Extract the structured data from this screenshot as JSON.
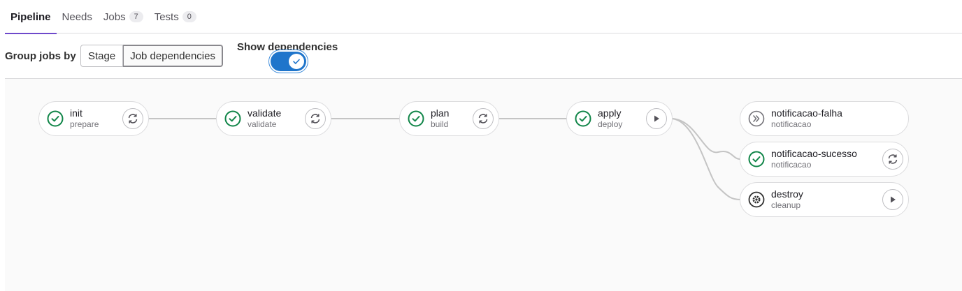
{
  "tabs": [
    {
      "label": "Pipeline",
      "count": null
    },
    {
      "label": "Needs",
      "count": null
    },
    {
      "label": "Jobs",
      "count": "7"
    },
    {
      "label": "Tests",
      "count": "0"
    }
  ],
  "toolbar": {
    "group_label": "Group jobs by",
    "stage_label": "Stage",
    "job_dependencies_label": "Job dependencies",
    "selected_grouping": "Job dependencies",
    "show_dependencies_label": "Show dependencies",
    "show_dependencies_on": true
  },
  "jobs": [
    {
      "name": "init",
      "stage": "prepare",
      "status": "success",
      "action": "retry"
    },
    {
      "name": "validate",
      "stage": "validate",
      "status": "success",
      "action": "retry"
    },
    {
      "name": "plan",
      "stage": "build",
      "status": "success",
      "action": "retry"
    },
    {
      "name": "apply",
      "stage": "deploy",
      "status": "success",
      "action": "play"
    },
    {
      "name": "notificacao-falha",
      "stage": "notificacao",
      "status": "skipped",
      "action": "none"
    },
    {
      "name": "notificacao-sucesso",
      "stage": "notificacao",
      "status": "success",
      "action": "retry"
    },
    {
      "name": "destroy",
      "stage": "cleanup",
      "status": "manual",
      "action": "play"
    }
  ],
  "colors": {
    "success": "#108548",
    "tab_accent": "#6e49cb",
    "toggle": "#1f75cb",
    "link": "#c4c4c4"
  },
  "icons": {
    "success": "status-success-icon",
    "skipped": "status-skipped-icon",
    "manual": "status-manual-gear-icon",
    "retry": "retry-icon",
    "play": "play-icon",
    "check": "check-icon"
  }
}
